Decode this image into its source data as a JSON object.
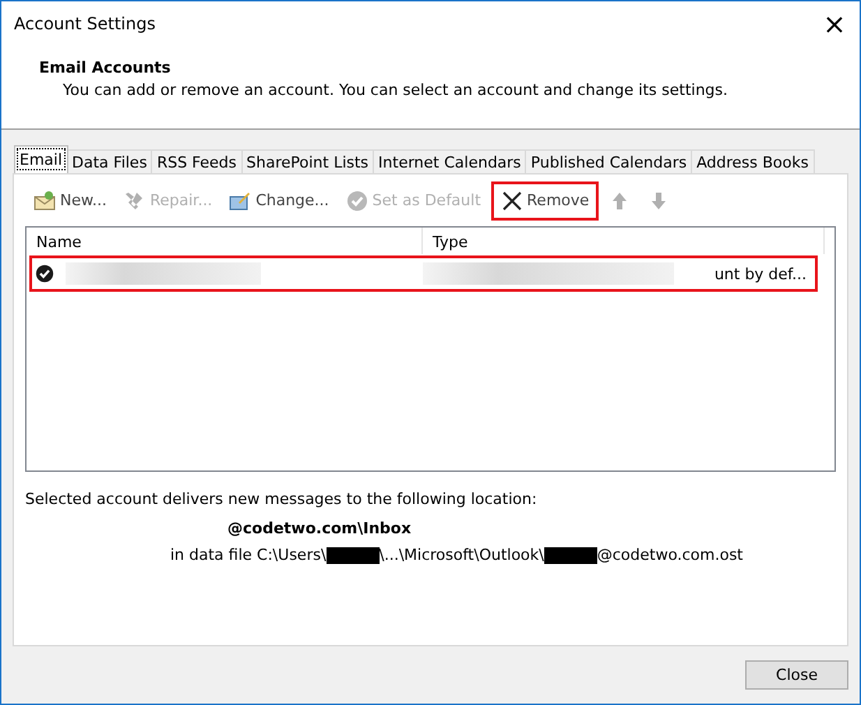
{
  "window": {
    "title": "Account Settings",
    "close": "×"
  },
  "header": {
    "title": "Email Accounts",
    "subtitle": "You can add or remove an account. You can select an account and change its settings."
  },
  "tabs": [
    {
      "label": "Email",
      "selected": true
    },
    {
      "label": "Data Files",
      "selected": false
    },
    {
      "label": "RSS Feeds",
      "selected": false
    },
    {
      "label": "SharePoint Lists",
      "selected": false
    },
    {
      "label": "Internet Calendars",
      "selected": false
    },
    {
      "label": "Published Calendars",
      "selected": false
    },
    {
      "label": "Address Books",
      "selected": false
    }
  ],
  "toolbar": [
    {
      "kind": "new",
      "label": "New...",
      "disabled": false,
      "highlighted": false
    },
    {
      "kind": "repair",
      "label": "Repair...",
      "disabled": true,
      "highlighted": false
    },
    {
      "kind": "change",
      "label": "Change...",
      "disabled": false,
      "highlighted": false
    },
    {
      "kind": "default",
      "label": "Set as Default",
      "disabled": true,
      "highlighted": false
    },
    {
      "kind": "remove",
      "label": "Remove",
      "disabled": false,
      "highlighted": true
    },
    {
      "kind": "up",
      "disabled": true,
      "highlighted": false
    },
    {
      "kind": "down",
      "disabled": true,
      "highlighted": false
    }
  ],
  "table": {
    "columns": [
      "Name",
      "Type"
    ],
    "rows": [
      {
        "default": true,
        "highlighted": true,
        "type": "unt by def..."
      }
    ]
  },
  "location": {
    "label": "Selected account delivers new messages to the following location:",
    "folder": "@codetwo.com\\Inbox",
    "path": [
      {
        "kind": "text",
        "text": "in data file C:\\Users\\"
      },
      {
        "kind": "redacted"
      },
      {
        "kind": "text",
        "text": "\\...\\Microsoft\\Outlook\\"
      },
      {
        "kind": "redacted"
      },
      {
        "kind": "text",
        "text": "@codetwo.com.ost"
      }
    ]
  },
  "buttons": [
    {
      "label": "Close"
    }
  ]
}
